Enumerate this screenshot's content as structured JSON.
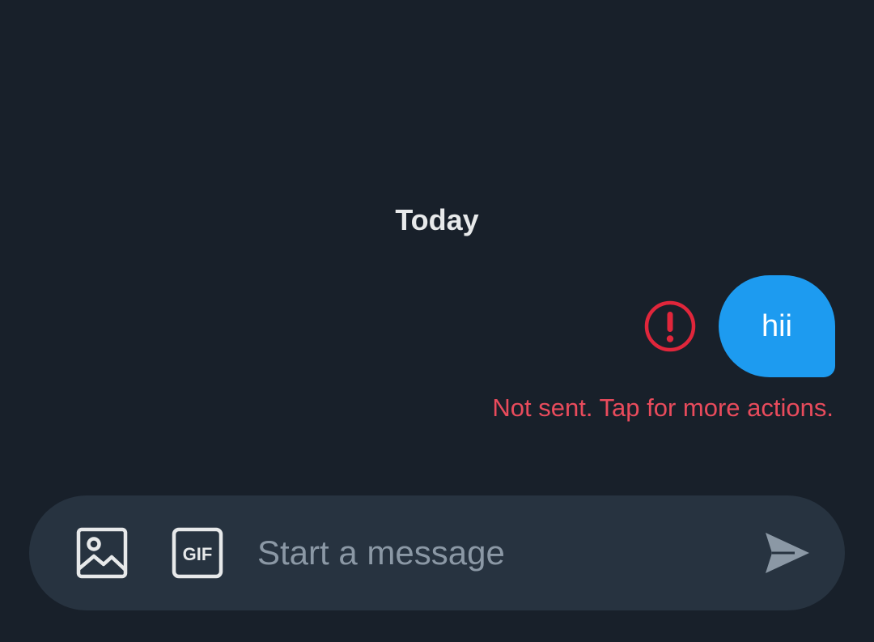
{
  "conversation": {
    "date_divider": "Today",
    "messages": [
      {
        "text": "hii",
        "direction": "outgoing",
        "status_icon": "error-exclamation-icon",
        "status_text": "Not sent. Tap for more actions."
      }
    ]
  },
  "composer": {
    "placeholder": "Start a message",
    "value": "",
    "media_icon": "image-icon",
    "gif_icon": "gif-icon",
    "gif_label": "GIF",
    "send_icon": "send-icon"
  },
  "colors": {
    "background": "#18202a",
    "bubble": "#1d9bf0",
    "error": "#e0263b",
    "error_text": "#e94b5c",
    "composer_background": "#273340",
    "icon": "#e7e9ea",
    "send_icon": "#8b98a5"
  }
}
